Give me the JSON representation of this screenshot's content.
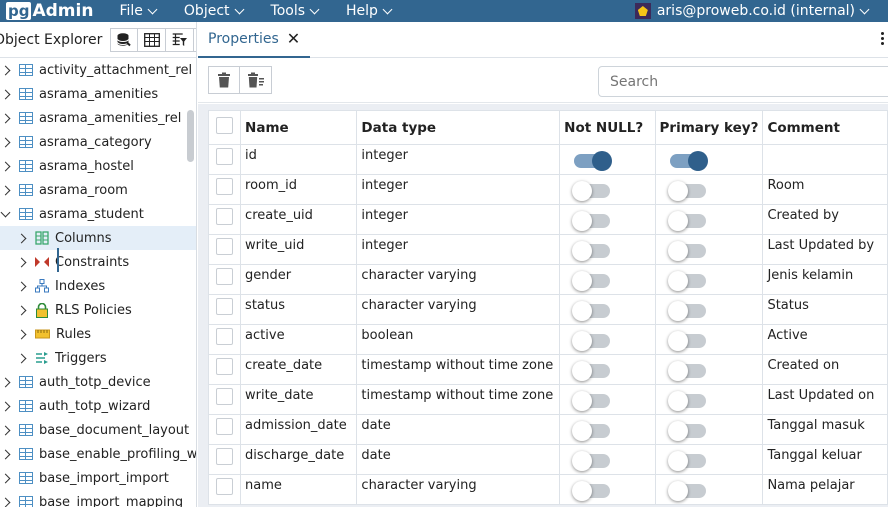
{
  "app": {
    "logo_pg": "pg",
    "logo_admin": "Admin"
  },
  "menu": [
    {
      "label": "File"
    },
    {
      "label": "Object"
    },
    {
      "label": "Tools"
    },
    {
      "label": "Help"
    }
  ],
  "user": {
    "label": "aris@proweb.co.id (internal)"
  },
  "explorer": {
    "title": "Object Explorer",
    "tree": [
      {
        "label": "activity_attachment_rel",
        "kind": "table"
      },
      {
        "label": "asrama_amenities",
        "kind": "table"
      },
      {
        "label": "asrama_amenities_rel",
        "kind": "table"
      },
      {
        "label": "asrama_category",
        "kind": "table"
      },
      {
        "label": "asrama_hostel",
        "kind": "table"
      },
      {
        "label": "asrama_room",
        "kind": "table"
      },
      {
        "label": "asrama_student",
        "kind": "table",
        "open": true
      },
      {
        "label": "Columns",
        "kind": "columns",
        "child": true,
        "selected": true
      },
      {
        "label": "Constraints",
        "kind": "constraints",
        "child": true
      },
      {
        "label": "Indexes",
        "kind": "indexes",
        "child": true
      },
      {
        "label": "RLS Policies",
        "kind": "rls",
        "child": true
      },
      {
        "label": "Rules",
        "kind": "rules",
        "child": true
      },
      {
        "label": "Triggers",
        "kind": "triggers",
        "child": true
      },
      {
        "label": "auth_totp_device",
        "kind": "table"
      },
      {
        "label": "auth_totp_wizard",
        "kind": "table"
      },
      {
        "label": "base_document_layout",
        "kind": "table"
      },
      {
        "label": "base_enable_profiling_wi",
        "kind": "table"
      },
      {
        "label": "base_import_import",
        "kind": "table"
      },
      {
        "label": "base_import_mapping",
        "kind": "table"
      }
    ]
  },
  "tab": {
    "label": "Properties"
  },
  "search": {
    "placeholder": "Search"
  },
  "grid": {
    "headers": {
      "name": "Name",
      "type": "Data type",
      "notnull": "Not NULL?",
      "pk": "Primary key?",
      "comment": "Comment"
    },
    "rows": [
      {
        "name": "id",
        "type": "integer",
        "notnull": true,
        "pk": true,
        "comment": ""
      },
      {
        "name": "room_id",
        "type": "integer",
        "notnull": false,
        "pk": false,
        "comment": "Room"
      },
      {
        "name": "create_uid",
        "type": "integer",
        "notnull": false,
        "pk": false,
        "comment": "Created by"
      },
      {
        "name": "write_uid",
        "type": "integer",
        "notnull": false,
        "pk": false,
        "comment": "Last Updated by"
      },
      {
        "name": "gender",
        "type": "character varying",
        "notnull": false,
        "pk": false,
        "comment": "Jenis kelamin"
      },
      {
        "name": "status",
        "type": "character varying",
        "notnull": false,
        "pk": false,
        "comment": "Status"
      },
      {
        "name": "active",
        "type": "boolean",
        "notnull": false,
        "pk": false,
        "comment": "Active"
      },
      {
        "name": "create_date",
        "type": "timestamp without time zone",
        "notnull": false,
        "pk": false,
        "comment": "Created on"
      },
      {
        "name": "write_date",
        "type": "timestamp without time zone",
        "notnull": false,
        "pk": false,
        "comment": "Last Updated on"
      },
      {
        "name": "admission_date",
        "type": "date",
        "notnull": false,
        "pk": false,
        "comment": "Tanggal masuk"
      },
      {
        "name": "discharge_date",
        "type": "date",
        "notnull": false,
        "pk": false,
        "comment": "Tanggal keluar"
      },
      {
        "name": "name",
        "type": "character varying",
        "notnull": false,
        "pk": false,
        "comment": "Nama pelajar"
      }
    ]
  },
  "colors": {
    "brand": "#326690",
    "switch_on": "#2f5f8b",
    "switch_track_on": "#7da0c2",
    "switch_off": "#c7ccd1"
  }
}
